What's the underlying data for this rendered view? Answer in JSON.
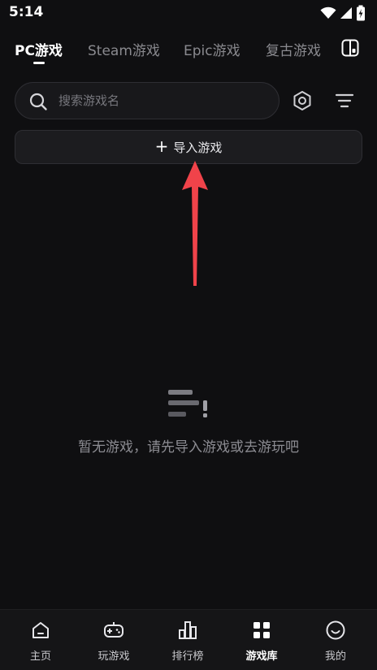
{
  "status_bar": {
    "time": "5:14"
  },
  "tabs": [
    {
      "label": "PC游戏",
      "active": true
    },
    {
      "label": "Steam游戏",
      "active": false
    },
    {
      "label": "Epic游戏",
      "active": false
    },
    {
      "label": "复古游戏",
      "active": false
    }
  ],
  "search": {
    "placeholder": "搜索游戏名"
  },
  "import_button": {
    "label": "导入游戏"
  },
  "empty_state": {
    "message": "暂无游戏，请先导入游戏或去游玩吧"
  },
  "bottom_nav": [
    {
      "label": "主页",
      "icon": "home-icon"
    },
    {
      "label": "玩游戏",
      "icon": "gamepad-icon"
    },
    {
      "label": "排行榜",
      "icon": "ranking-icon"
    },
    {
      "label": "游戏库",
      "icon": "grid-icon",
      "active": true
    },
    {
      "label": "我的",
      "icon": "smiley-icon"
    }
  ],
  "colors": {
    "background": "#0f0f11",
    "annotation_arrow": "#f0434a"
  }
}
